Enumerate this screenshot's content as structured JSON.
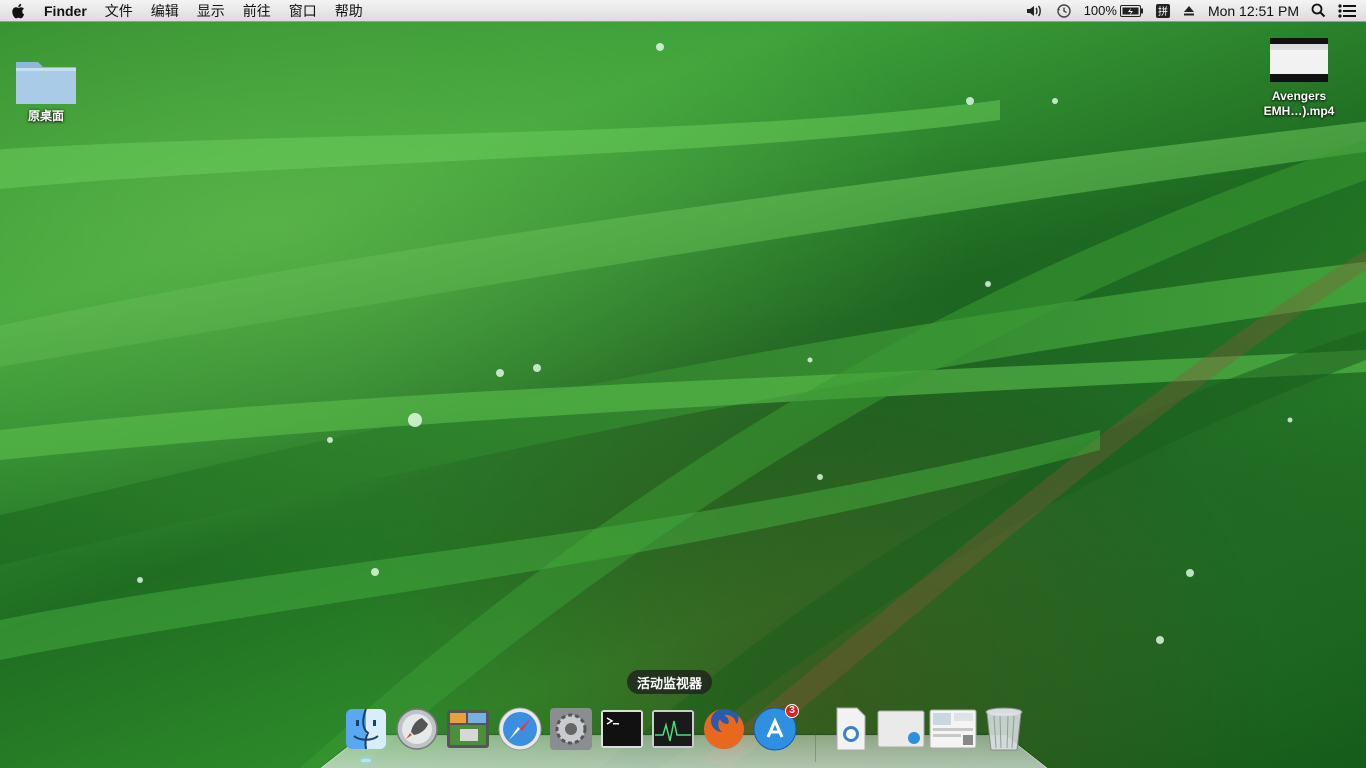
{
  "menubar": {
    "app_name": "Finder",
    "menus": [
      "文件",
      "编辑",
      "显示",
      "前往",
      "窗口",
      "帮助"
    ],
    "status": {
      "battery": "100%",
      "input_method": "拼",
      "clock": "Mon 12:51 PM"
    }
  },
  "desktop": {
    "icons": [
      {
        "label": "原桌面",
        "icon": "folder-icon"
      },
      {
        "label": "Avengers EMH…).mp4",
        "icon": "video-file-icon"
      }
    ]
  },
  "dock": {
    "tooltip": "活动监视器",
    "items": [
      {
        "name": "Finder",
        "icon": "finder-icon",
        "running": true
      },
      {
        "name": "Launchpad",
        "icon": "launchpad-icon"
      },
      {
        "name": "Photo Viewer",
        "icon": "photos-icon"
      },
      {
        "name": "Safari",
        "icon": "safari-icon"
      },
      {
        "name": "System Preferences",
        "icon": "system-preferences-icon"
      },
      {
        "name": "Terminal",
        "icon": "terminal-icon"
      },
      {
        "name": "Activity Monitor",
        "icon": "activity-monitor-icon"
      },
      {
        "name": "Firefox",
        "icon": "firefox-icon"
      },
      {
        "name": "App Store",
        "icon": "app-store-icon",
        "badge": "3"
      },
      {
        "name": "Downloads",
        "icon": "downloads-stack-icon"
      },
      {
        "name": "Applications",
        "icon": "applications-stack-icon"
      },
      {
        "name": "Documents",
        "icon": "documents-stack-icon"
      },
      {
        "name": "Trash",
        "icon": "trash-icon"
      }
    ]
  },
  "colors": {
    "wallpaper_green": "#2f8a2c",
    "menubar_bg": "#e8e8e8",
    "badge_red": "#e02020"
  }
}
